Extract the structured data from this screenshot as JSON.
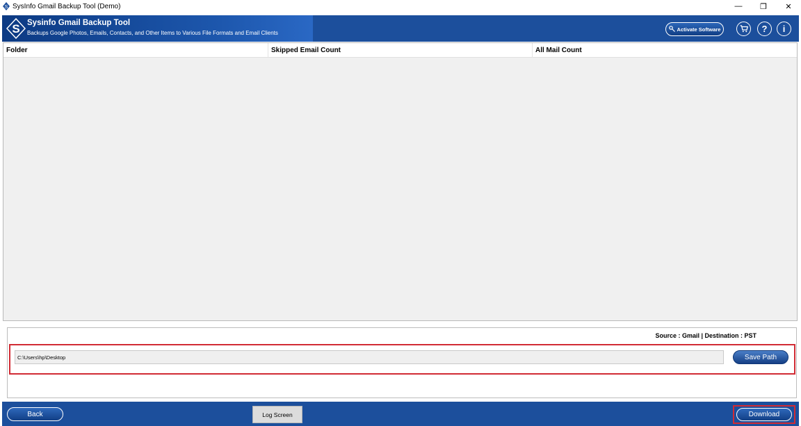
{
  "window": {
    "title": "SysInfo Gmail Backup Tool (Demo)",
    "minimize": "—",
    "restore": "❐",
    "close": "✕"
  },
  "header": {
    "logo_letter": "S",
    "title": "Sysinfo Gmail Backup Tool",
    "subtitle": "Backups Google Photos, Emails, Contacts, and Other Items to Various File Formats and Email Clients",
    "activate_label": "Activate Software",
    "cart_icon": "cart-icon",
    "help_glyph": "?",
    "info_glyph": "i"
  },
  "table": {
    "columns": [
      "Folder",
      "Skipped Email Count",
      "All Mail Count"
    ],
    "rows": []
  },
  "status": {
    "source_destination": "Source : Gmail | Destination : PST",
    "path_value": "C:\\Users\\hp\\Desktop",
    "save_path_label": "Save Path"
  },
  "footer": {
    "back_label": "Back",
    "log_screen_label": "Log Screen",
    "download_label": "Download"
  },
  "colors": {
    "header_bg": "#1c4f9c",
    "highlight_red": "#d12b34"
  }
}
